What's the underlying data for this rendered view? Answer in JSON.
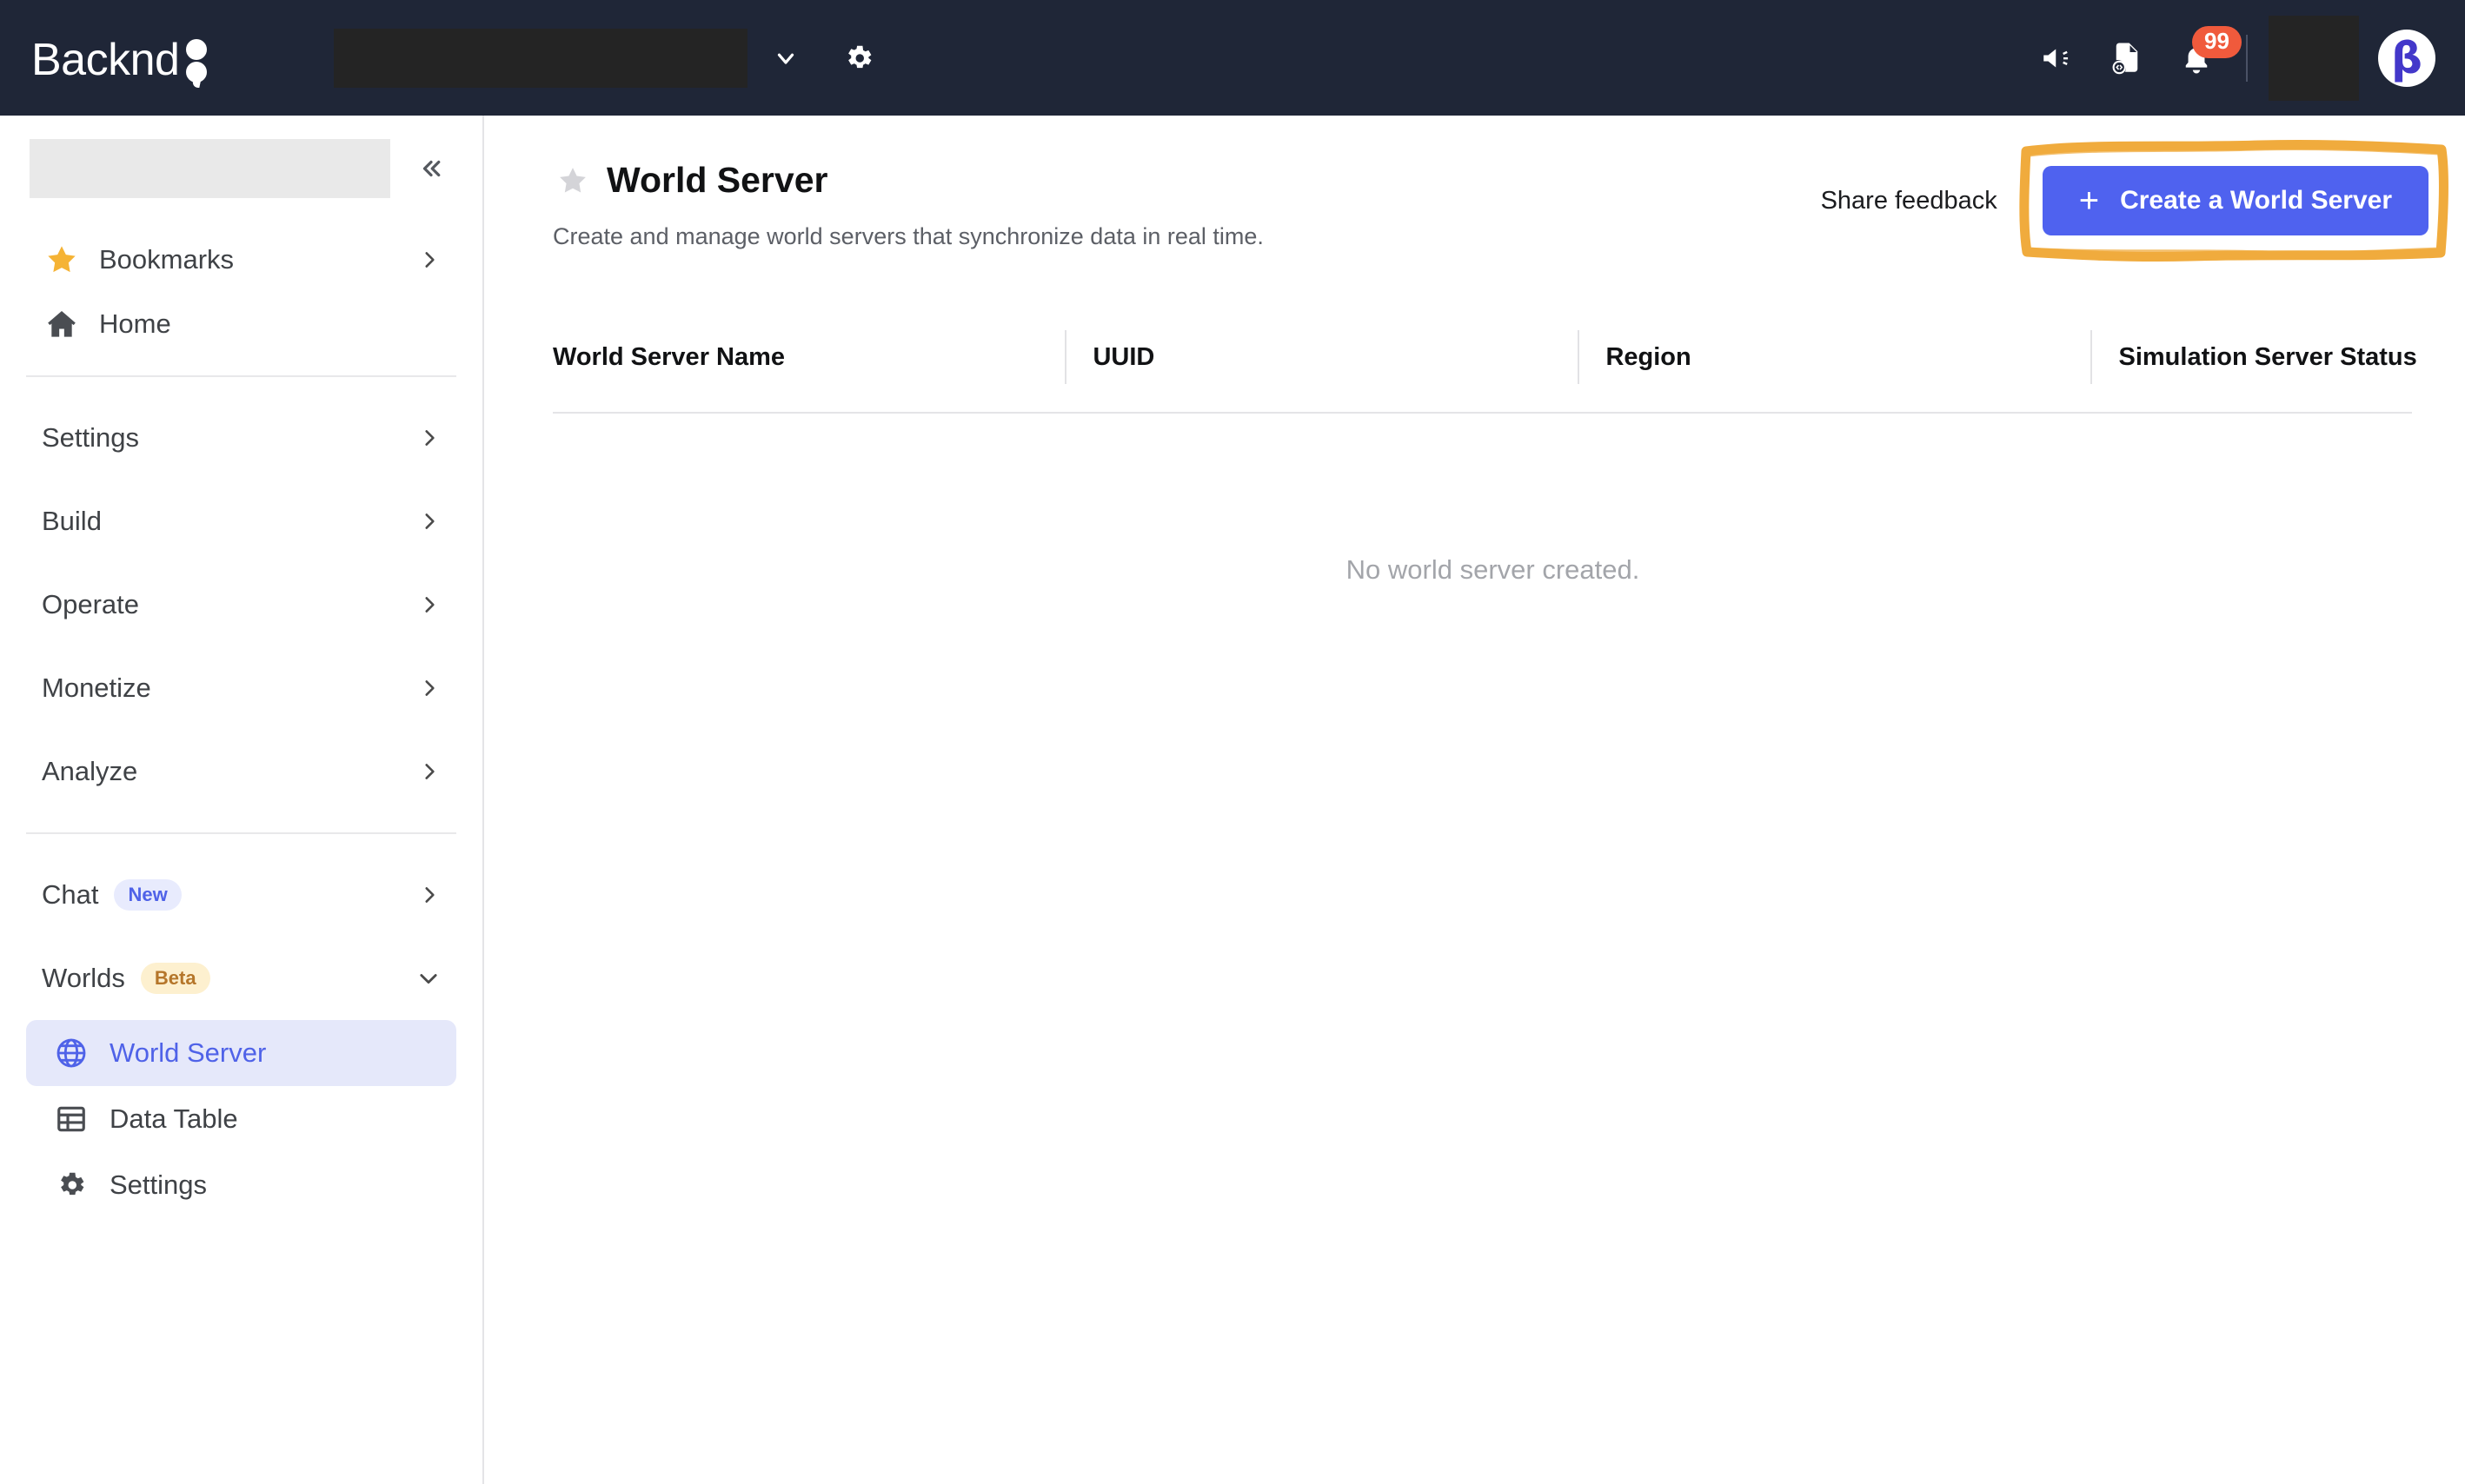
{
  "topbar": {
    "logo_text": "Backnd",
    "logo_mark_icon": "two-dots-mark",
    "project_selector_value": "",
    "project_chevron_icon": "chevron-down-icon",
    "settings_icon": "gear-icon",
    "announcement_icon": "megaphone-icon",
    "api_docs_icon": "file-code-icon",
    "notifications_icon": "bell-icon",
    "notification_count": "99",
    "user_name_redacted": "",
    "avatar_initial": "β"
  },
  "sidebar": {
    "project_placeholder": "",
    "collapse_icon": "chevron-double-left-icon",
    "collapse_label": "«",
    "quick_items": [
      {
        "label": "Bookmarks",
        "icon": "star-icon",
        "chevron": "chevron-right-icon"
      },
      {
        "label": "Home",
        "icon": "home-icon",
        "chevron": ""
      }
    ],
    "groups": [
      {
        "label": "Settings",
        "chevron": "chevron-right-icon"
      },
      {
        "label": "Build",
        "chevron": "chevron-right-icon"
      },
      {
        "label": "Operate",
        "chevron": "chevron-right-icon"
      },
      {
        "label": "Monetize",
        "chevron": "chevron-right-icon"
      },
      {
        "label": "Analyze",
        "chevron": "chevron-right-icon"
      }
    ],
    "chat": {
      "label": "Chat",
      "badge": "New",
      "chevron": "chevron-right-icon"
    },
    "worlds": {
      "label": "Worlds",
      "badge": "Beta",
      "chevron": "chevron-down-icon"
    },
    "worlds_items": [
      {
        "label": "World Server",
        "icon": "globe-icon",
        "active": true
      },
      {
        "label": "Data Table",
        "icon": "table-icon",
        "active": false
      },
      {
        "label": "Settings",
        "icon": "gear-icon",
        "active": false
      }
    ]
  },
  "page": {
    "favorite_icon": "star-outline-icon",
    "title": "World Server",
    "subtitle": "Create and manage world servers that synchronize data in real time.",
    "feedback_label": "Share feedback",
    "create_button_label": "Create a World Server",
    "create_button_icon": "plus-icon"
  },
  "table": {
    "columns": [
      "World Server Name",
      "UUID",
      "Region",
      "Simulation Server Status"
    ],
    "rows": [],
    "empty_message": "No world server created."
  },
  "colors": {
    "topbar_bg": "#1f2637",
    "primary_blue": "#4f62ef",
    "active_item_bg": "#e5e8fa",
    "badge_red": "#f05a3c",
    "beta_badge_bg": "#fdf0cf",
    "annotation_orange": "#f0ab3d",
    "star_gold": "#f5b335"
  }
}
